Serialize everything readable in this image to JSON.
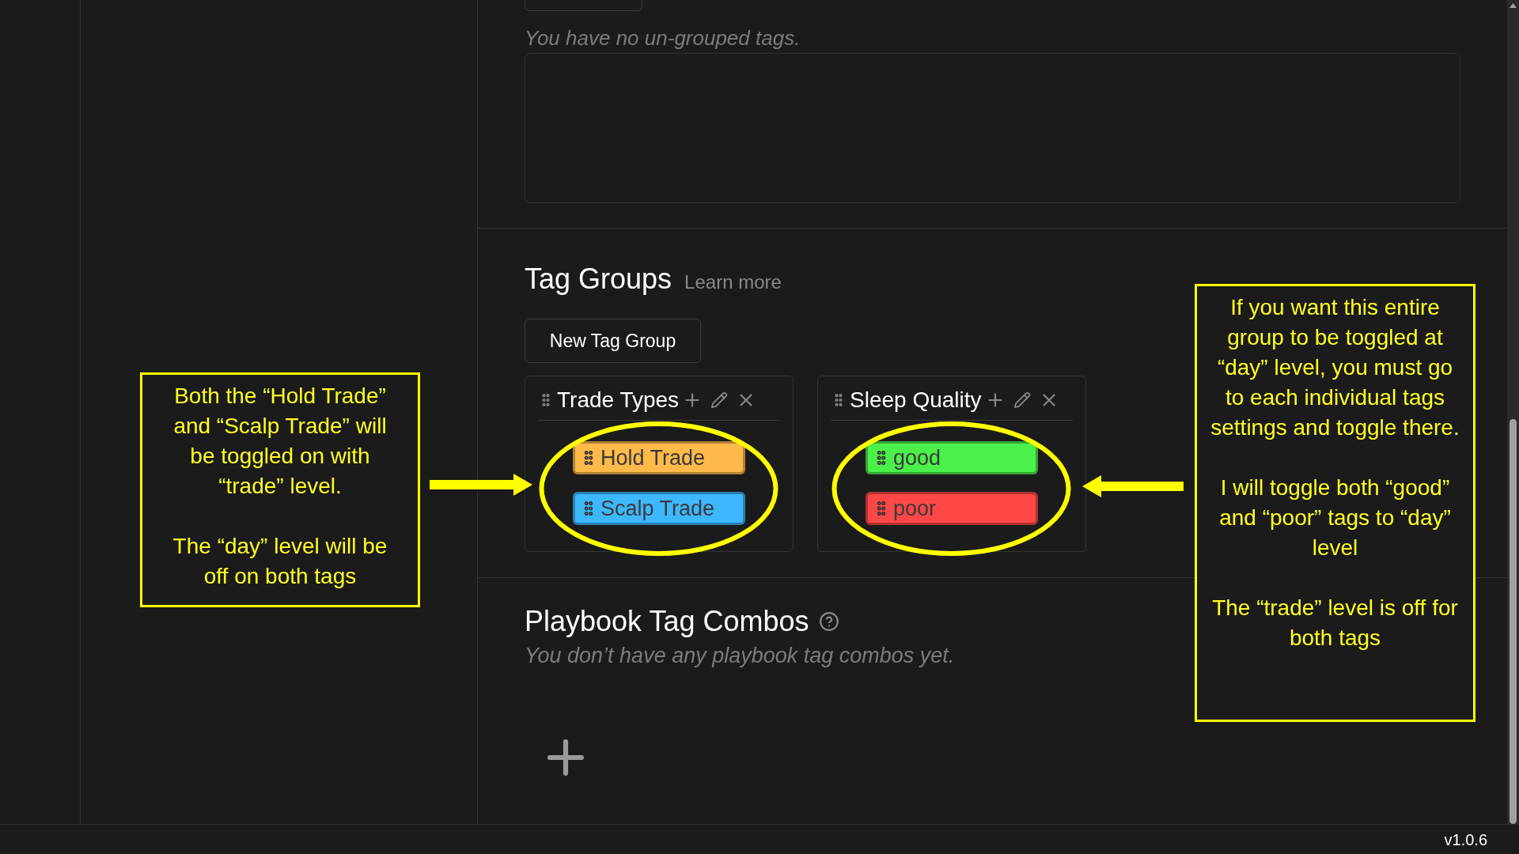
{
  "ungrouped": {
    "empty_message": "You have no un-grouped tags."
  },
  "tag_groups": {
    "title": "Tag Groups",
    "learn_more": "Learn more",
    "new_button": "New Tag Group",
    "groups": [
      {
        "name": "Trade Types",
        "tags": [
          {
            "label": "Hold Trade",
            "color": "#ffba4a"
          },
          {
            "label": "Scalp Trade",
            "color": "#3db8ff"
          }
        ]
      },
      {
        "name": "Sleep Quality",
        "tags": [
          {
            "label": "good",
            "color": "#4cf04a"
          },
          {
            "label": "poor",
            "color": "#ff4747"
          }
        ]
      }
    ]
  },
  "playbook": {
    "title": "Playbook Tag Combos",
    "empty_message": "You don’t have any playbook tag combos yet."
  },
  "version": "v1.0.6",
  "annotations": [
    {
      "kind": "left",
      "paragraphs": [
        "Both the “Hold Trade” and “Scalp Trade” will be toggled on with “trade” level.",
        "The “day” level will be off on both tags"
      ]
    },
    {
      "kind": "right",
      "paragraphs": [
        "If you want this entire group to be toggled at “day” level, you must go to each individual tags settings and toggle there.",
        "I will toggle both “good” and “poor” tags to “day” level",
        "The “trade” level is off for both tags"
      ]
    }
  ]
}
